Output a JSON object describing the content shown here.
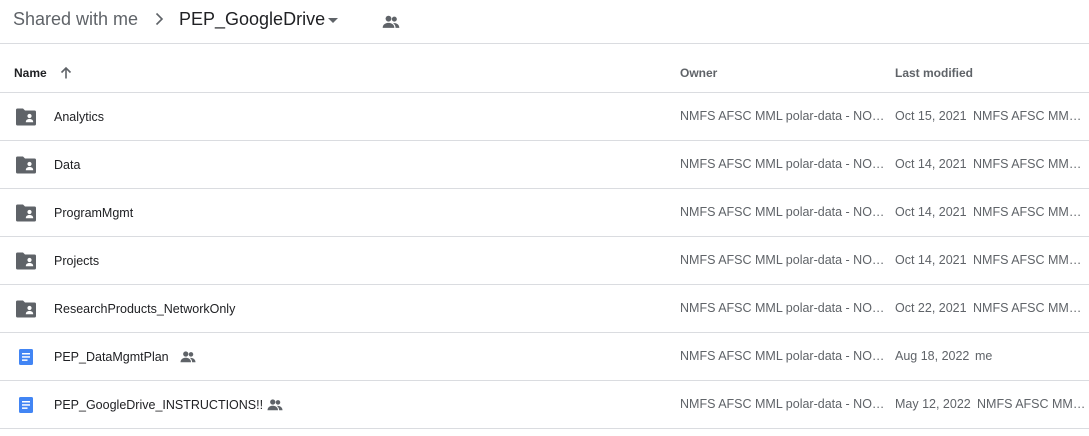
{
  "breadcrumb": {
    "root": "Shared with me",
    "current": "PEP_GoogleDrive"
  },
  "icons": {
    "breadcrumb_separator": "chevron-right-icon",
    "dropdown": "caret-down-icon",
    "shared": "people-icon",
    "sort": "arrow-up-icon",
    "folder": "shared-folder-icon",
    "doc": "google-doc-icon"
  },
  "colors": {
    "folder": "#5f6368",
    "doc": "#4285f4",
    "divider": "#dadce0"
  },
  "columns": {
    "name": "Name",
    "owner": "Owner",
    "last_modified": "Last modified"
  },
  "rows": [
    {
      "name": "Analytics",
      "type": "folder",
      "shared": false,
      "owner": "NMFS AFSC MML polar-data - NO…",
      "date": "Oct 15, 2021",
      "modified_by": "NMFS AFSC MM…"
    },
    {
      "name": "Data",
      "type": "folder",
      "shared": false,
      "owner": "NMFS AFSC MML polar-data - NO…",
      "date": "Oct 14, 2021",
      "modified_by": "NMFS AFSC MM…"
    },
    {
      "name": "ProgramMgmt",
      "type": "folder",
      "shared": false,
      "owner": "NMFS AFSC MML polar-data - NO…",
      "date": "Oct 14, 2021",
      "modified_by": "NMFS AFSC MM…"
    },
    {
      "name": "Projects",
      "type": "folder",
      "shared": false,
      "owner": "NMFS AFSC MML polar-data - NO…",
      "date": "Oct 14, 2021",
      "modified_by": "NMFS AFSC MM…"
    },
    {
      "name": "ResearchProducts_NetworkOnly",
      "type": "folder",
      "shared": false,
      "owner": "NMFS AFSC MML polar-data - NO…",
      "date": "Oct 22, 2021",
      "modified_by": "NMFS AFSC MM…"
    },
    {
      "name": "PEP_DataMgmtPlan",
      "type": "doc",
      "shared": true,
      "owner": "NMFS AFSC MML polar-data - NO…",
      "date": "Aug 18, 2022",
      "modified_by": "me"
    },
    {
      "name": "PEP_GoogleDrive_INSTRUCTIONS!!",
      "type": "doc",
      "shared": true,
      "owner": "NMFS AFSC MML polar-data - NO…",
      "date": "May 12, 2022",
      "modified_by": "NMFS AFSC MM…"
    }
  ]
}
